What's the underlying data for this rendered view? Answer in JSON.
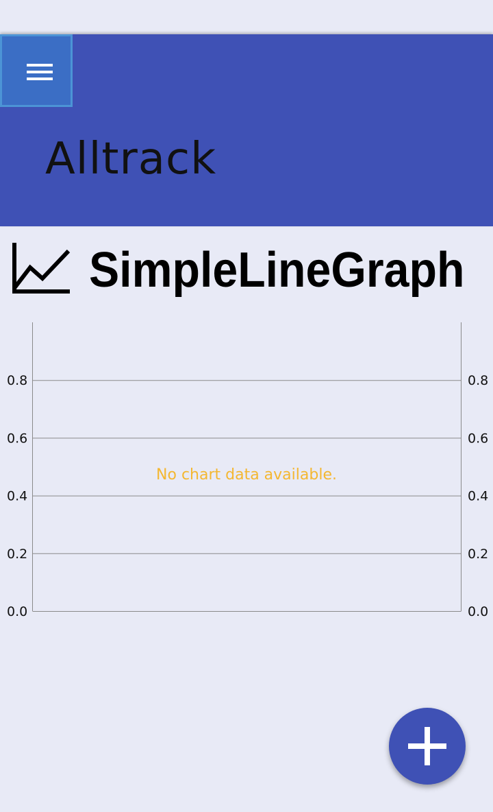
{
  "app": {
    "title": "Alltrack",
    "menu_icon": "hamburger-menu-icon"
  },
  "graph": {
    "icon": "line-chart-icon",
    "title": "SimpleLineGraph"
  },
  "chart_data": {
    "type": "line",
    "series": [],
    "empty_message": "No chart data available.",
    "ylim": [
      0,
      1
    ],
    "yticks": [
      "0.0",
      "0.2",
      "0.4",
      "0.6",
      "0.8"
    ],
    "grid": true,
    "colors": {
      "empty_message": "#f4b731",
      "grid": "#8a8a8a"
    }
  },
  "fab": {
    "icon": "plus-icon"
  },
  "colors": {
    "primary": "#3f51b5",
    "background": "#e8eaf6",
    "menu_highlight": "#3b6ec5"
  }
}
